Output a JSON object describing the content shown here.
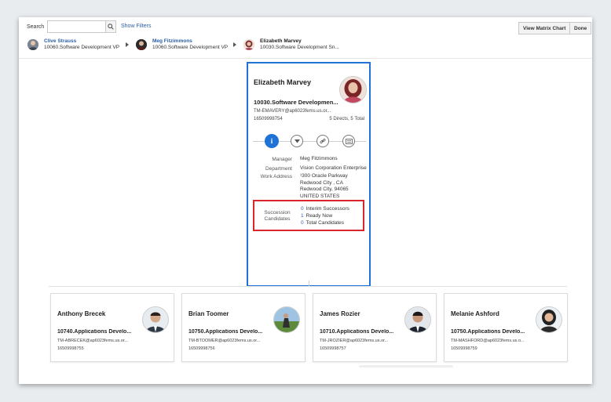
{
  "search": {
    "label": "Search",
    "value": "",
    "show_filters": "Show Filters"
  },
  "toolbar": {
    "view_matrix": "View Matrix Chart",
    "done": "Done"
  },
  "breadcrumbs": [
    {
      "name": "Clive Strauss",
      "title": "10060.Software Development VP"
    },
    {
      "name": "Meg Fitzimmons",
      "title": "10060.Software Development VP"
    },
    {
      "name": "Elizabeth Marvey",
      "title": "10030.Software Development Sn..."
    }
  ],
  "main_card": {
    "name": "Elizabeth Marvey",
    "title": "10030.Software Developmen...",
    "email": "TM-EMAVERY@ap6023fems.us.or...",
    "phone": "16509998754",
    "directs": "5 Directs, 5 Total",
    "manager_label": "Manager",
    "manager": "Meg Fitzimmons",
    "department_label": "Department",
    "department": "Vision Corporation Enterprise",
    "work_address_label": "Work Address",
    "address_lines": [
      "¹300 Oracle Parkway",
      "Redwood City , CA",
      "Redwood City, 94065",
      "UNITED STATES"
    ],
    "succession_label": "Succession Candidates",
    "succession": [
      {
        "count": "0",
        "label": "Interim Successors"
      },
      {
        "count": "1",
        "label": "Ready Now"
      },
      {
        "count": "0",
        "label": "Total Candidates"
      }
    ]
  },
  "directs": [
    {
      "name": "Anthony Brecek",
      "title": "10740.Applications Develo...",
      "email": "TM-ABRECEK@ap6023fems.us.or...",
      "phone": "16509998755"
    },
    {
      "name": "Brian Toomer",
      "title": "10750.Applications Develo...",
      "email": "TM-BTOOMER@ap6023fems.us.or...",
      "phone": "16509998756"
    },
    {
      "name": "James Rozier",
      "title": "10710.Applications Develo...",
      "email": "TM-JROZIER@ap6023fems.us.or...",
      "phone": "16509998757"
    },
    {
      "name": "Melanie Ashford",
      "title": "10750.Applications Develo...",
      "email": "TM-MASHFORD@ap6023fems.us.o...",
      "phone": "16509998759"
    }
  ],
  "colors": {
    "accent": "#1f73d6",
    "highlight": "#d8262c",
    "link": "#2a5fa9"
  }
}
